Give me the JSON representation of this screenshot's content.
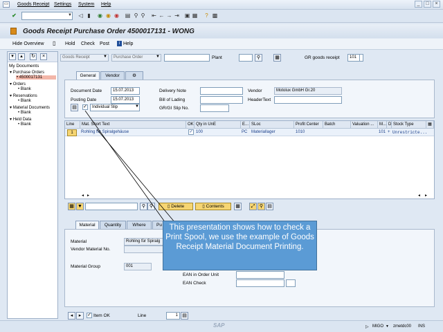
{
  "menu": {
    "items": [
      "Goods Receipt",
      "Settings",
      "System",
      "Help"
    ]
  },
  "toolbar": {
    "icons": [
      "enter-icon",
      "save-icon",
      "back-icon",
      "exit-icon",
      "cancel-icon",
      "print-icon",
      "find-icon",
      "find-next-icon",
      "first-page-icon",
      "prev-page-icon",
      "next-page-icon",
      "last-page-icon",
      "new-session-icon",
      "shortcut-icon",
      "help-icon",
      "customize-icon"
    ]
  },
  "title": "Goods Receipt Purchase Order 4500017131 - WONG",
  "app_toolbar": {
    "hide_overview": "Hide Overview",
    "hold": "Hold",
    "check": "Check",
    "post": "Post",
    "help": "Help"
  },
  "left_panel": {
    "title": "My Documents",
    "items": [
      {
        "label": "Purchase Orders",
        "level": 0
      },
      {
        "label": "4500017131",
        "level": 1,
        "selected": true
      },
      {
        "label": "Orders",
        "level": 0
      },
      {
        "label": "Blank",
        "level": 1
      },
      {
        "label": "Reservations",
        "level": 0
      },
      {
        "label": "Blank",
        "level": 1
      },
      {
        "label": "Material Documents",
        "level": 0
      },
      {
        "label": "Blank",
        "level": 1
      },
      {
        "label": "Held Data",
        "level": 0
      },
      {
        "label": "Blank",
        "level": 1
      }
    ]
  },
  "header_row": {
    "transaction": "Goods Receipt",
    "reference": "Purchase Order",
    "plant_label": "Plant",
    "gr_label": "GR goods receipt",
    "movement_type": "101"
  },
  "header_tabs": {
    "general": "General",
    "vendor": "Vendor"
  },
  "general": {
    "document_date_label": "Document Date",
    "document_date": "15.07.2013",
    "posting_date_label": "Posting Date",
    "posting_date": "15.07.2013",
    "delivery_note_label": "Delivery Note",
    "bill_of_lading_label": "Bill of Lading",
    "grgi_slip_label": "GR/GI Slip No.",
    "vendor_label": "Vendor",
    "vendor": "Motolux GmbH Gr.20",
    "header_text_label": "HeaderText",
    "print_option": "Individual Slip"
  },
  "items_grid": {
    "columns": [
      "Line",
      "Mat. Short Text",
      "OK",
      "Qty in UnE",
      "E...",
      "SLoc",
      "Profit Center",
      "Batch",
      "Valuation ...",
      "M...",
      "D",
      "Stock Type"
    ],
    "rows": [
      {
        "line": "1",
        "text": "Rohling für Spiralgehäuse",
        "ok": "✓",
        "qty": "100",
        "unit": "PC",
        "sloc": "Materiallager",
        "profit": "1010",
        "batch": "",
        "valuation": "",
        "mvt": "101",
        "d": "+",
        "stock": "Unrestricte..."
      }
    ]
  },
  "grid_toolbar": {
    "delete": "Delete",
    "contents": "Contents"
  },
  "detail_tabs": {
    "material": "Material",
    "quantity": "Quantity",
    "where": "Where",
    "pu": "Pu"
  },
  "material_tab": {
    "material_label": "Material",
    "material": "Rohling für Spiralg",
    "vendor_material_label": "Vendor Material No.",
    "material_group_label": "Material Group",
    "material_group": "001",
    "ean_unit_label": "EAN in Order Unit",
    "ean_check_label": "EAN Check"
  },
  "bottom": {
    "item_ok": "Item OK",
    "line_label": "Line",
    "line_value": "1"
  },
  "callout": "This presentation shows how to check a Print Spool, we use the example of Goods Receipt Material Document Printing.",
  "status": {
    "sap": "SAP",
    "transaction": "MIGO",
    "server": "zmetdc00",
    "mode": "INS"
  }
}
